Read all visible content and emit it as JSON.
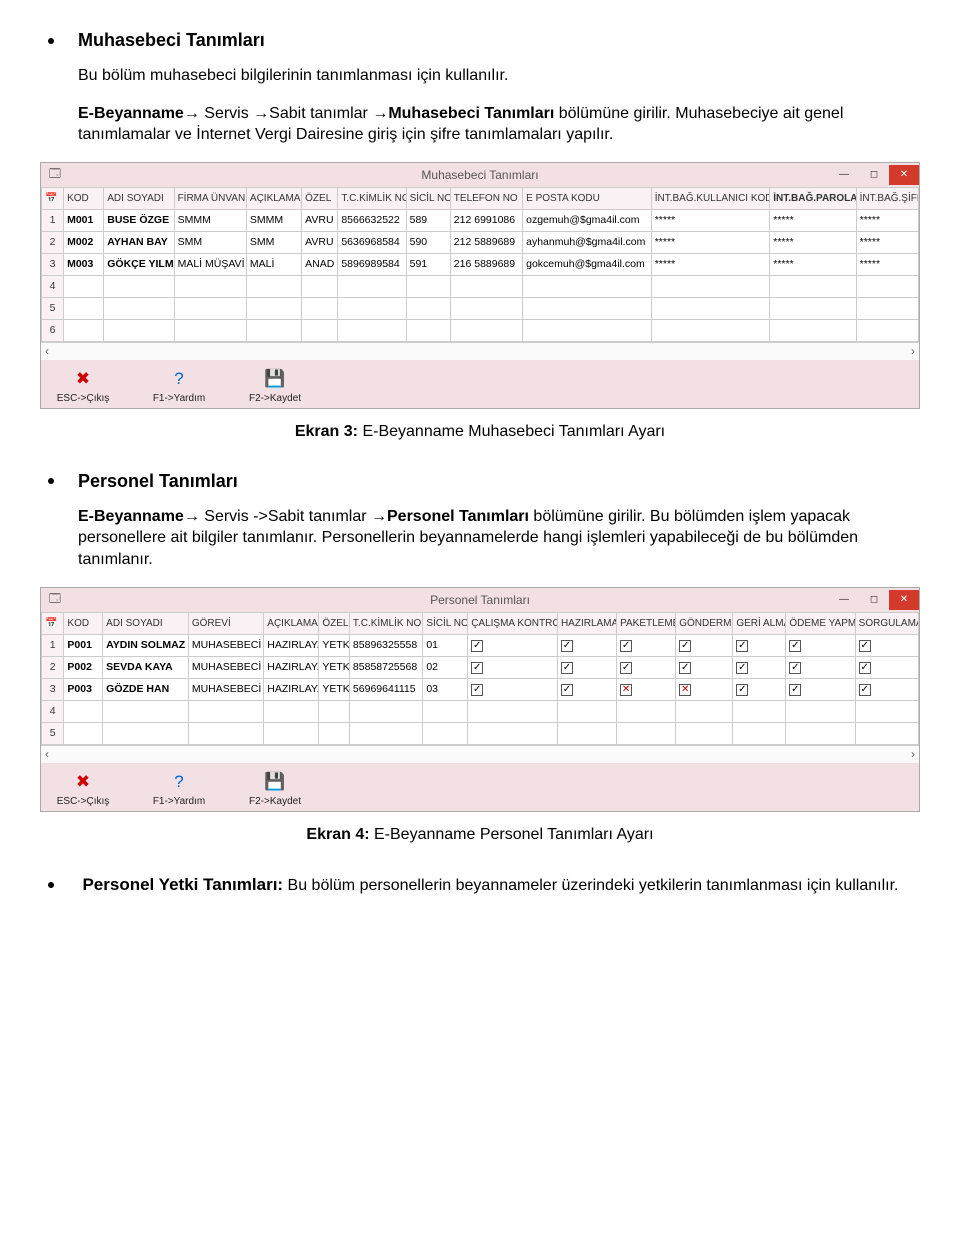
{
  "section1": {
    "title": "Muhasebeci Tanımları",
    "para1": "Bu bölüm muhasebeci bilgilerinin tanımlanması için kullanılır.",
    "nav_bold1": "E-Beyanname→",
    "nav_plain": " Servis →Sabit tanımlar →",
    "nav_bold2": "Muhasebeci Tanımları",
    "nav_tail": " bölümüne girilir. Muhasebeciye ait genel tanımlamalar ve İnternet Vergi Dairesine giriş için şifre tanımlamaları yapılır."
  },
  "win1": {
    "title": "Muhasebeci Tanımları",
    "headers": [
      "",
      "KOD",
      "ADI SOYADI",
      "FİRMA ÜNVANI",
      "AÇIKLAMA",
      "ÖZEL",
      "T.C.KİMLİK NO",
      "SİCİL NO",
      "TELEFON NO",
      "E POSTA KODU",
      "İNT.BAĞ.KULLANICI KODU",
      "İNT.BAĞ.PAROLAS",
      "İNT.BAĞ.ŞİFRE"
    ],
    "rows": [
      {
        "n": "1",
        "kod": "M001",
        "ad": "BUSE ÖZGE",
        "firma": "SMMM",
        "acik": "SMMM",
        "ozel": "AVRU",
        "tc": "8566632522",
        "sicil": "589",
        "tel": "212 6991086",
        "eposta": "ozgemuh@$gma4il.com",
        "kull": "*****",
        "parola": "*****",
        "sifre": "*****"
      },
      {
        "n": "2",
        "kod": "M002",
        "ad": "AYHAN BAY",
        "firma": "SMM",
        "acik": "SMM",
        "ozel": "AVRU",
        "tc": "5636968584",
        "sicil": "590",
        "tel": "212 5889689",
        "eposta": "ayhanmuh@$gma4il.com",
        "kull": "*****",
        "parola": "*****",
        "sifre": "*****"
      },
      {
        "n": "3",
        "kod": "M003",
        "ad": "GÖKÇE YILM",
        "firma": "MALİ MÜŞAVİ",
        "acik": "MALİ",
        "ozel": "ANAD",
        "tc": "5896989584",
        "sicil": "591",
        "tel": "216 5889689",
        "eposta": "gokcemuh@$gma4il.com",
        "kull": "*****",
        "parola": "*****",
        "sifre": "*****"
      },
      {
        "n": "4"
      },
      {
        "n": "5"
      },
      {
        "n": "6"
      }
    ],
    "toolbar": [
      {
        "icon": "✖",
        "color": "#c00",
        "label": "ESC->Çıkış"
      },
      {
        "icon": "?",
        "color": "#06c",
        "label": "F1->Yardım"
      },
      {
        "icon": "💾",
        "color": "#333",
        "label": "F2->Kaydet"
      }
    ]
  },
  "cap1_bold": "Ekran 3:",
  "cap1_rest": " E-Beyanname Muhasebeci Tanımları Ayarı",
  "section2": {
    "title": "Personel Tanımları",
    "nav_bold1": "E-Beyanname→",
    "nav_plain": " Servis ->Sabit tanımlar →",
    "nav_bold2": "Personel Tanımları",
    "nav_tail": " bölümüne girilir. Bu bölümden işlem yapacak personellere ait bilgiler tanımlanır. Personellerin beyannamelerde hangi işlemleri yapabileceği de bu bölümden tanımlanır."
  },
  "win2": {
    "title": "Personel Tanımları",
    "headers": [
      "",
      "KOD",
      "ADI SOYADI",
      "GÖREVİ",
      "AÇIKLAMA",
      "ÖZEL",
      "T.C.KİMLİK NO",
      "SİCİL NO",
      "ÇALIŞMA KONTROLÜ",
      "HAZIRLAMA",
      "PAKETLEME",
      "GÖNDERME",
      "GERİ ALMA",
      "ÖDEME YAPMA",
      "SORGULAMA"
    ],
    "rows": [
      {
        "n": "1",
        "kod": "P001",
        "ad": "AYDIN SOLMAZ",
        "gorev": "MUHASEBECİ",
        "acik": "HAZIRLAY.",
        "ozel": "YETK",
        "tc": "85896325558",
        "sicil": "01",
        "cb": [
          "chk",
          "chk",
          "chk",
          "chk",
          "chk",
          "chk",
          "chk"
        ]
      },
      {
        "n": "2",
        "kod": "P002",
        "ad": "SEVDA KAYA",
        "gorev": "MUHASEBECİ",
        "acik": "HAZIRLAY.",
        "ozel": "YETK",
        "tc": "85858725568",
        "sicil": "02",
        "cb": [
          "chk",
          "chk",
          "chk",
          "chk",
          "chk",
          "chk",
          "chk"
        ]
      },
      {
        "n": "3",
        "kod": "P003",
        "ad": "GÖZDE HAN",
        "gorev": "MUHASEBECİ",
        "acik": "HAZIRLAY.",
        "ozel": "YETK",
        "tc": "56969641115",
        "sicil": "03",
        "cb": [
          "chk",
          "chk",
          "x",
          "x",
          "chk",
          "chk",
          "chk"
        ]
      },
      {
        "n": "4"
      },
      {
        "n": "5"
      }
    ],
    "toolbar": [
      {
        "icon": "✖",
        "color": "#c00",
        "label": "ESC->Çıkış"
      },
      {
        "icon": "?",
        "color": "#06c",
        "label": "F1->Yardım"
      },
      {
        "icon": "💾",
        "color": "#333",
        "label": "F2->Kaydet"
      }
    ]
  },
  "cap2_bold": "Ekran 4:",
  "cap2_rest": " E-Beyanname Personel Tanımları Ayarı",
  "section3": {
    "title_bold": "Personel Yetki Tanımları:",
    "title_rest": " Bu bölüm personellerin beyannameler üzerindeki yetkilerin tanımlanması için kullanılır."
  }
}
